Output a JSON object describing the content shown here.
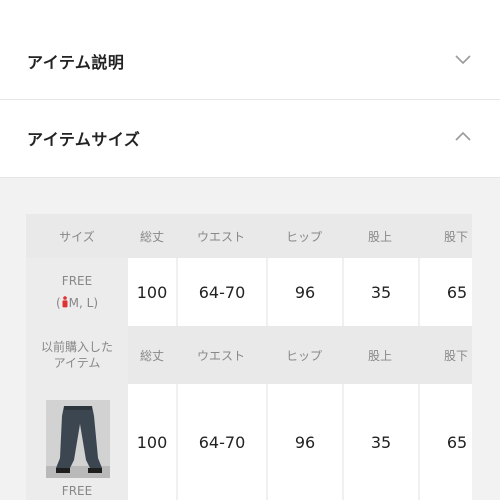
{
  "sections": [
    {
      "title": "アイテム説明",
      "state": "collapsed",
      "chevron_icon": "chevron-down-icon"
    },
    {
      "title": "アイテムサイズ",
      "state": "expanded",
      "chevron_icon": "chevron-up-icon"
    }
  ],
  "size_table": {
    "columns": [
      "サイズ",
      "総丈",
      "ウエスト",
      "ヒップ",
      "股上",
      "股下"
    ],
    "size_row": {
      "size": "FREE",
      "size_note_prefix": "(",
      "size_note_icon": "person-icon",
      "size_note": "M, L)",
      "values": [
        "100",
        "64-70",
        "96",
        "35",
        "65"
      ]
    },
    "previous_header": {
      "label": "以前購入した\nアイテム",
      "columns": [
        "総丈",
        "ウエスト",
        "ヒップ",
        "股上",
        "股下"
      ]
    },
    "previous_row": {
      "thumbnail_icon": "product-thumbnail",
      "size": "FREE",
      "values": [
        "100",
        "64-70",
        "96",
        "35",
        "65"
      ]
    }
  },
  "colors": {
    "accent_red": "#e03030",
    "header_bg": "#e9e9e9",
    "page_bg": "#f2f2f2"
  }
}
